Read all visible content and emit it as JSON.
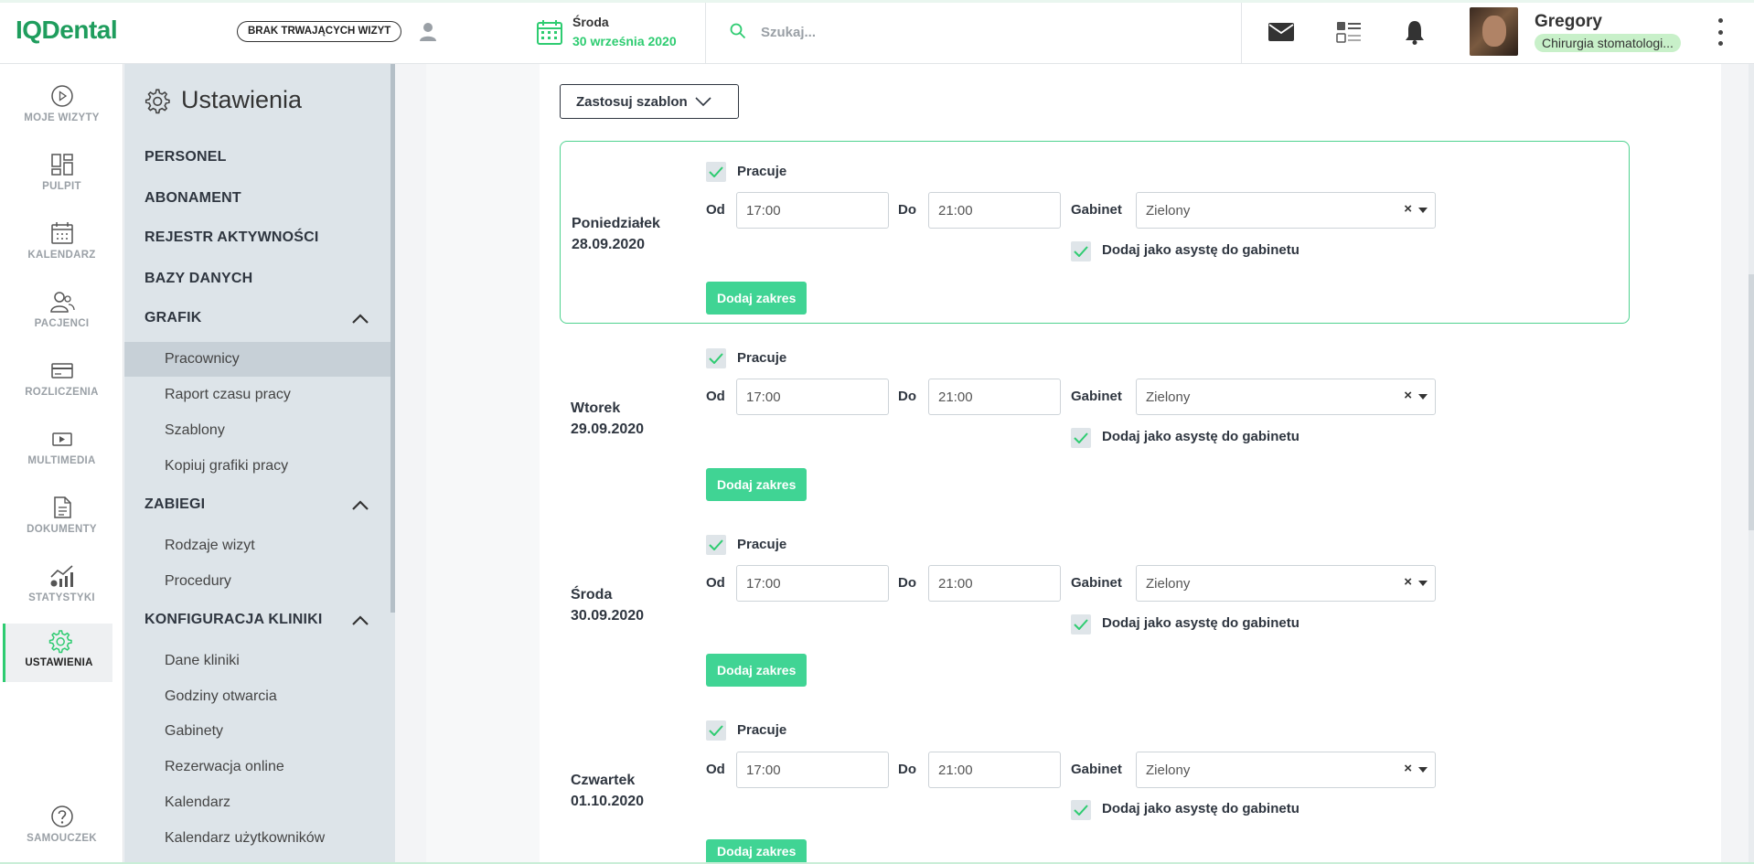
{
  "header": {
    "logo": "IQDental",
    "visits_badge": "BRAK TRWAJĄCYCH WIZYT",
    "date_day": "Środa",
    "date_full": "30 września 2020",
    "search_placeholder": "Szukaj...",
    "user_name": "Gregory",
    "user_role": "Chirurgia stomatologi..."
  },
  "rail": {
    "items": [
      {
        "label": "MOJE WIZYTY",
        "icon": "play-circle-icon"
      },
      {
        "label": "PULPIT",
        "icon": "dashboard-icon"
      },
      {
        "label": "KALENDARZ",
        "icon": "calendar-icon"
      },
      {
        "label": "PACJENCI",
        "icon": "patients-icon"
      },
      {
        "label": "ROZLICZENIA",
        "icon": "card-icon"
      },
      {
        "label": "MULTIMEDIA",
        "icon": "media-icon"
      },
      {
        "label": "DOKUMENTY",
        "icon": "document-icon"
      },
      {
        "label": "STATYSTYKI",
        "icon": "stats-icon"
      },
      {
        "label": "USTAWIENIA",
        "icon": "gear-icon"
      },
      {
        "label": "SAMOUCZEK",
        "icon": "help-icon"
      }
    ]
  },
  "settings": {
    "title": "Ustawienia",
    "sections": {
      "personel": "PERSONEL",
      "abonament": "ABONAMENT",
      "rejestr": "REJESTR AKTYWNOŚCI",
      "bazy": "BAZY DANYCH",
      "grafik": "GRAFIK",
      "zabiegi": "ZABIEGI",
      "konfiguracja": "KONFIGURACJA KLINIKI"
    },
    "grafik_items": [
      "Pracownicy",
      "Raport czasu pracy",
      "Szablony",
      "Kopiuj grafiki pracy"
    ],
    "zabiegi_items": [
      "Rodzaje wizyt",
      "Procedury"
    ],
    "konfiguracja_items": [
      "Dane kliniki",
      "Godziny otwarcia",
      "Gabinety",
      "Rezerwacja online",
      "Kalendarz",
      "Kalendarz użytkowników"
    ]
  },
  "main": {
    "template_button": "Zastosuj szablon",
    "labels": {
      "works": "Pracuje",
      "from": "Od",
      "to": "Do",
      "room": "Gabinet",
      "assistant": "Dodaj jako asystę do gabinetu",
      "add_range": "Dodaj zakres"
    },
    "days": [
      {
        "name": "Poniedziałek",
        "date": "28.09.2020",
        "from": "17:00",
        "to": "21:00",
        "room": "Zielony"
      },
      {
        "name": "Wtorek",
        "date": "29.09.2020",
        "from": "17:00",
        "to": "21:00",
        "room": "Zielony"
      },
      {
        "name": "Środa",
        "date": "30.09.2020",
        "from": "17:00",
        "to": "21:00",
        "room": "Zielony"
      },
      {
        "name": "Czwartek",
        "date": "01.10.2020",
        "from": "17:00",
        "to": "21:00",
        "room": "Zielony"
      }
    ]
  },
  "colors": {
    "accent": "#2ecc71",
    "brand": "#1f9d5d",
    "button": "#40d494",
    "sidebar": "#dde4e9"
  }
}
